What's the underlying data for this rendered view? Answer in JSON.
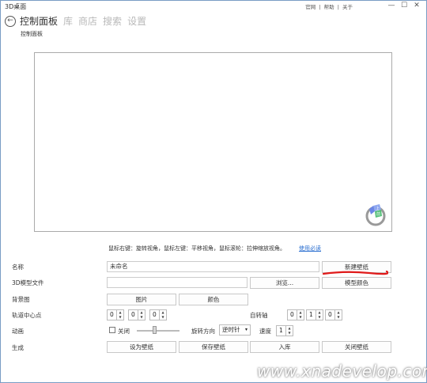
{
  "app_title": "3D桌面",
  "top_menu": {
    "website": "官网",
    "help": "帮助",
    "about": "关于",
    "sep": "|"
  },
  "window_buttons": {
    "minimize": "—",
    "maximize": "☐",
    "close": "✕"
  },
  "nav": {
    "tabs": [
      {
        "label": "控制面板",
        "active": true
      },
      {
        "label": "库"
      },
      {
        "label": "商店"
      },
      {
        "label": "搜索"
      },
      {
        "label": "设置"
      }
    ]
  },
  "breadcrumb": "控制面板",
  "hint": {
    "text": "鼠标右键：旋转视角，鼠标左键：平移视角，鼠标滚轮：拉伸缩放视角。",
    "link": "使用必读"
  },
  "form": {
    "name_label": "名称",
    "name_value": "未命名",
    "new_wallpaper": "新建壁纸",
    "model_label": "3D模型文件",
    "model_value": "",
    "browse": "浏览...",
    "model_color": "模型颜色",
    "bg_label": "背景图",
    "bg_image": "图片",
    "bg_color": "颜色",
    "orbit_label": "轨道中心点",
    "orbit_x": "0",
    "orbit_y": "0",
    "orbit_z": "0",
    "axis_label": "自转轴",
    "axis_x": "0",
    "axis_y": "1",
    "axis_z": "0",
    "anim_label": "动画",
    "anim_off": "关闭",
    "anim_slider_level": 0.4,
    "rotation_dir_label": "旋转方向",
    "rotation_dir_value": "逆时针",
    "speed_label": "速度",
    "speed_value": "1",
    "gen_label": "生成",
    "set_wallpaper": "设为壁纸",
    "save_wallpaper": "保存壁纸",
    "add_library": "入库",
    "close_wallpaper": "关闭壁纸"
  },
  "watermark": "www.xnadevelop.com",
  "colors": {
    "accent": "#2b6fd0",
    "annotation": "#e01a1a"
  }
}
